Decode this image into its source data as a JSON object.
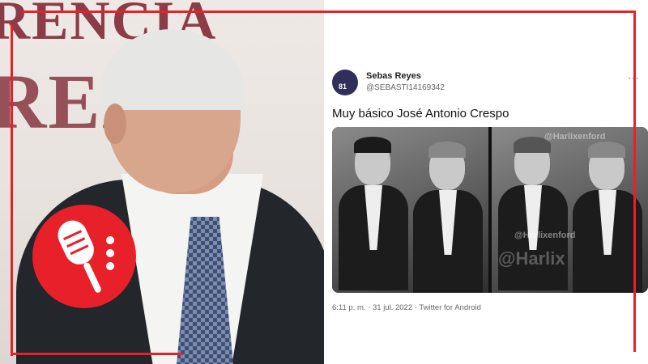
{
  "left_panel": {
    "background_text": [
      "RENCIA",
      "RENA"
    ],
    "badge_icon": "microphone-icon",
    "badge_color": "#e8202a"
  },
  "tweet": {
    "display_name": "Sebas Reyes",
    "handle": "@SEBASTI14169342",
    "avatar_text": "81",
    "text": "Muy básico José Antonio Crespo",
    "more_icon": "more-icon",
    "more_glyph": "⋯",
    "meta": "6:11 p. m. · 31 jul. 2022 · Twitter for Android",
    "media_watermarks": [
      "@Harlixenford",
      "@Harlixenford",
      "@Harlix"
    ]
  },
  "frame_color": "#e8202a"
}
